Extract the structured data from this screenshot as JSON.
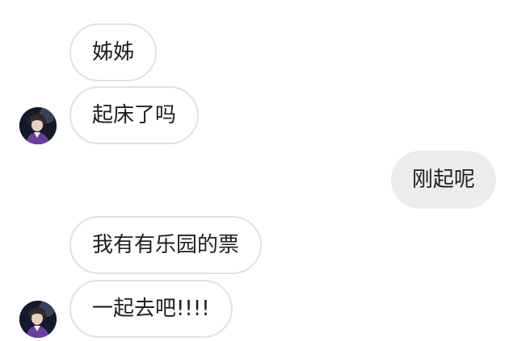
{
  "conversation": {
    "messages": [
      {
        "direction": "incoming",
        "text": "姊姊"
      },
      {
        "direction": "incoming",
        "text": "起床了吗"
      },
      {
        "direction": "outgoing",
        "text": "刚起呢"
      },
      {
        "direction": "incoming",
        "text": "我有有乐园的票"
      },
      {
        "direction": "incoming",
        "text": "一起去吧!!!!"
      }
    ]
  },
  "colors": {
    "background": "#ffffff",
    "incoming_bubble": "#ffffff",
    "incoming_border": "#e1e1e1",
    "outgoing_bubble": "#ededed",
    "text": "#1f1f1f"
  },
  "icons": {
    "sender_avatar": "avatar"
  }
}
